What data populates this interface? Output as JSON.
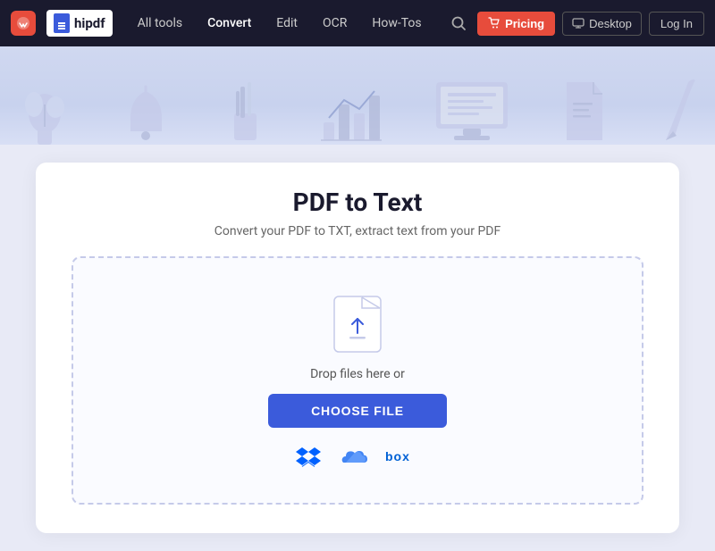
{
  "navbar": {
    "brand": "wondershare",
    "logo_text": "hipdf",
    "nav_links": [
      {
        "label": "All tools",
        "id": "all-tools"
      },
      {
        "label": "Convert",
        "id": "convert",
        "active": true
      },
      {
        "label": "Edit",
        "id": "edit"
      },
      {
        "label": "OCR",
        "id": "ocr"
      },
      {
        "label": "How-Tos",
        "id": "how-tos"
      }
    ],
    "pricing_label": "Pricing",
    "desktop_label": "Desktop",
    "login_label": "Log In"
  },
  "page": {
    "title": "PDF to Text",
    "subtitle": "Convert your PDF to TXT, extract text from your PDF",
    "drop_text": "Drop files here or",
    "choose_file_label": "CHOOSE FILE"
  },
  "cloud_providers": [
    {
      "name": "Dropbox",
      "id": "dropbox"
    },
    {
      "name": "OneDrive",
      "id": "onedrive"
    },
    {
      "name": "Box",
      "id": "box"
    }
  ]
}
